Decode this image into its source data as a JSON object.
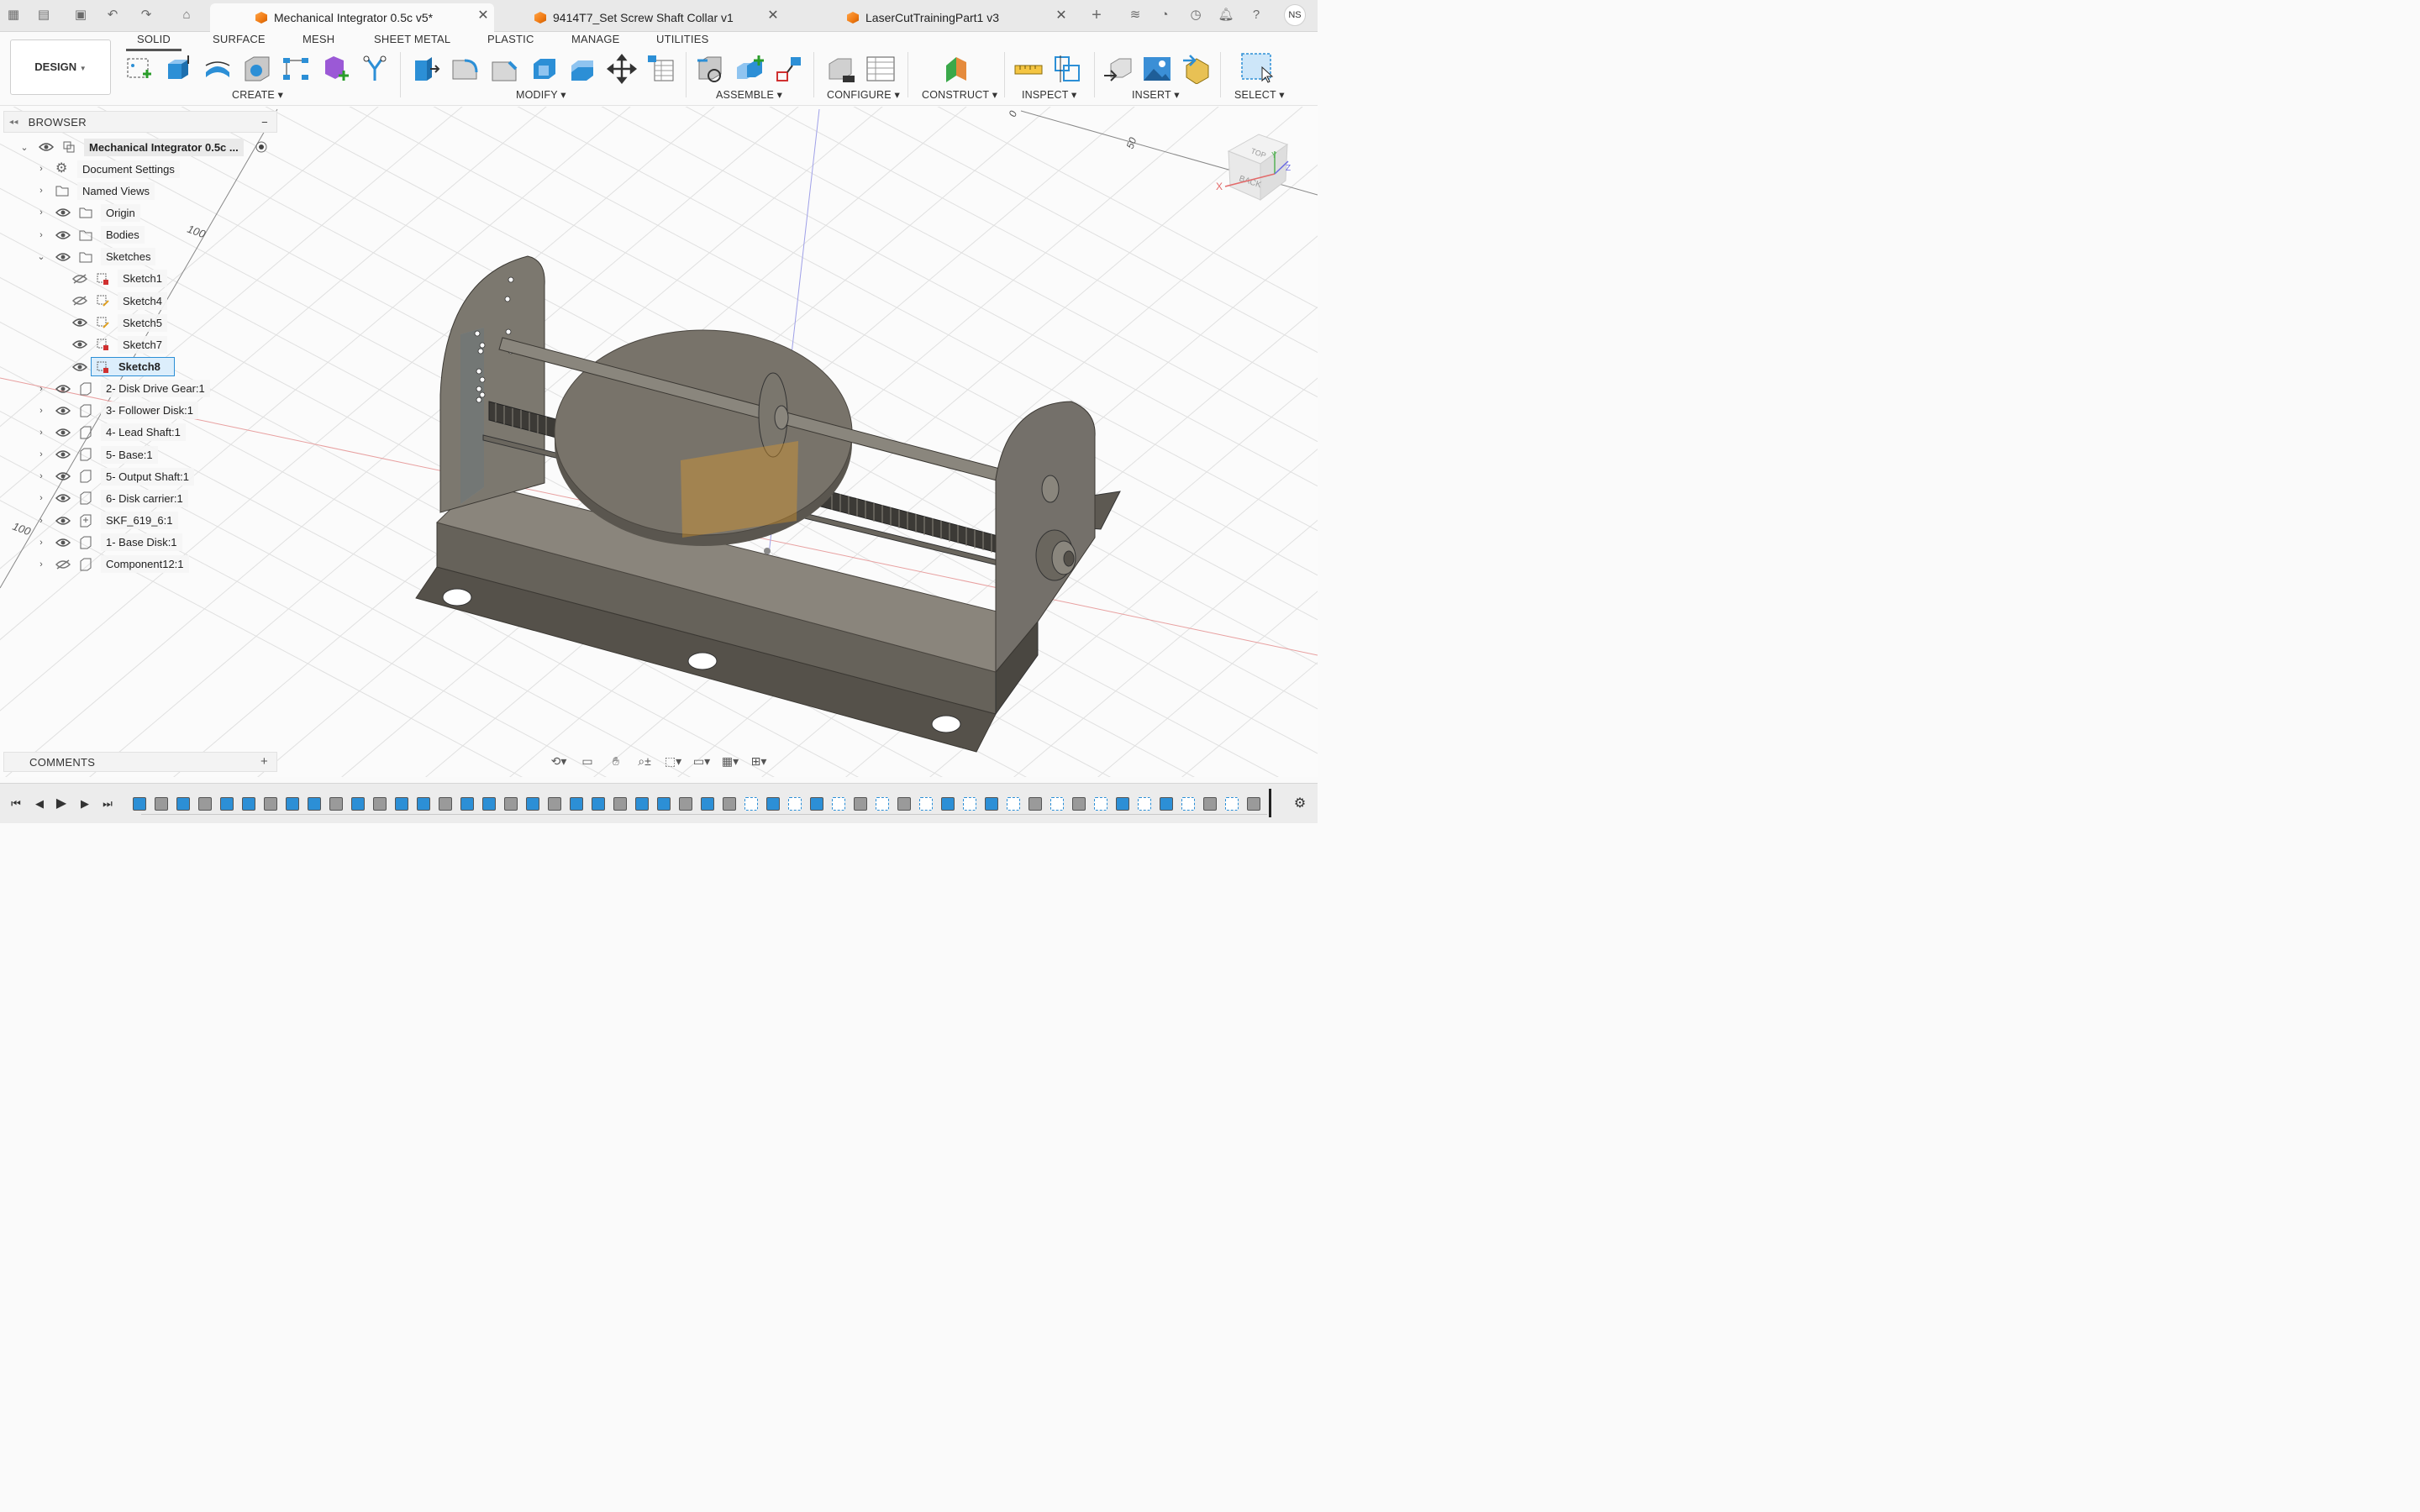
{
  "tabbar": {
    "tabs": [
      {
        "label": "Mechanical Integrator 0.5c v5*",
        "active": true
      },
      {
        "label": "9414T7_Set Screw Shaft Collar v1",
        "active": false
      },
      {
        "label": "LaserCutTrainingPart1 v3",
        "active": false
      }
    ],
    "close_glyph": "✕",
    "user_initials": "NS",
    "icons": [
      "grid-icon",
      "file-icon",
      "save-icon",
      "undo-icon",
      "redo-icon",
      "home-icon",
      "new-tab-icon",
      "extensions-icon",
      "job-status-icon",
      "clock-icon",
      "notifications-icon",
      "help-icon"
    ]
  },
  "toolbar": {
    "workspace_label": "DESIGN",
    "workspace_tabs": [
      "SOLID",
      "SURFACE",
      "MESH",
      "SHEET METAL",
      "PLASTIC",
      "MANAGE",
      "UTILITIES"
    ],
    "groups": [
      "CREATE",
      "MODIFY",
      "ASSEMBLE",
      "CONFIGURE",
      "CONSTRUCT",
      "INSPECT",
      "INSERT",
      "SELECT"
    ]
  },
  "browser": {
    "title": "BROWSER",
    "collapse_glyph": "−",
    "root": "Mechanical Integrator 0.5c ...",
    "items": [
      {
        "label": "Document Settings",
        "type": "settings",
        "eye": "none"
      },
      {
        "label": "Named Views",
        "type": "folder",
        "eye": "none"
      },
      {
        "label": "Origin",
        "type": "folder",
        "eye": "visible"
      },
      {
        "label": "Bodies",
        "type": "folder",
        "eye": "visible"
      },
      {
        "label": "Sketches",
        "type": "folder",
        "eye": "visible",
        "expanded": true
      },
      {
        "label": "Sketch1",
        "type": "sketch",
        "eye": "hidden"
      },
      {
        "label": "Sketch4",
        "type": "sketch",
        "eye": "hidden"
      },
      {
        "label": "Sketch5",
        "type": "sketch",
        "eye": "visible"
      },
      {
        "label": "Sketch7",
        "type": "sketch",
        "eye": "visible"
      },
      {
        "label": "Sketch8",
        "type": "sketch",
        "eye": "visible",
        "selected": true
      },
      {
        "label": "2- Disk Drive Gear:1",
        "type": "component",
        "eye": "visible"
      },
      {
        "label": "3- Follower Disk:1",
        "type": "component",
        "eye": "visible"
      },
      {
        "label": "4- Lead Shaft:1",
        "type": "component",
        "eye": "visible"
      },
      {
        "label": "5- Base:1",
        "type": "component",
        "eye": "visible"
      },
      {
        "label": "5- Output Shaft:1",
        "type": "component",
        "eye": "visible"
      },
      {
        "label": "6- Disk carrier:1",
        "type": "component",
        "eye": "visible"
      },
      {
        "label": "SKF_619_6:1",
        "type": "component-linked",
        "eye": "visible"
      },
      {
        "label": "1- Base Disk:1",
        "type": "component",
        "eye": "visible"
      },
      {
        "label": "Component12:1",
        "type": "component",
        "eye": "hidden"
      }
    ]
  },
  "viewport": {
    "grid_labels": [
      "100",
      "100",
      "0",
      "50"
    ],
    "viewcube": {
      "top": "TOP",
      "back": "BACK",
      "x": "X",
      "y": "Y",
      "z": "Z"
    }
  },
  "comments": {
    "title": "COMMENTS",
    "add_glyph": "+"
  },
  "colors": {
    "accent": "#2c8fd6",
    "model_metal": "#6e6a62",
    "disk_top": "#78736a",
    "tab_orange": "#f07b14"
  }
}
